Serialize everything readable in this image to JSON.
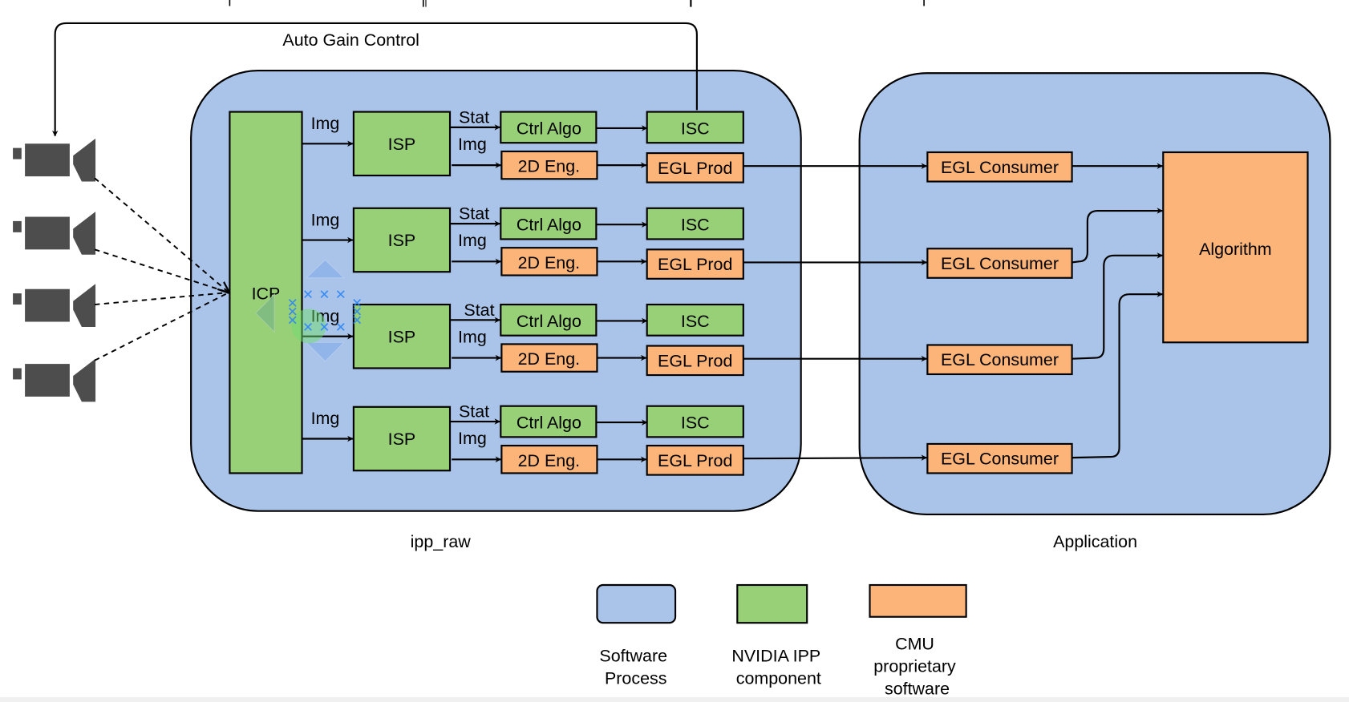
{
  "colors": {
    "software_process": "#a9c4e8",
    "nvidia_component": "#97d077",
    "cmu_software": "#fdb478",
    "stroke": "#000000",
    "camera": "#4d4d4d",
    "selection_handle": "#3399ff"
  },
  "top_labels": {
    "agc": "Auto Gain Control"
  },
  "containers": {
    "ipp_raw": "ipp_raw",
    "application": "Application"
  },
  "icp": {
    "label": "ICP"
  },
  "pipelines": [
    {
      "img_in": "Img",
      "isp": "ISP",
      "stat": "Stat",
      "img_out": "Img",
      "ctrl": "Ctrl Algo",
      "eng": "2D Eng.",
      "isc": "ISC",
      "prod": "EGL Prod",
      "consumer": "EGL Consumer"
    },
    {
      "img_in": "Img",
      "isp": "ISP",
      "stat": "Stat",
      "img_out": "Img",
      "ctrl": "Ctrl Algo",
      "eng": "2D Eng.",
      "isc": "ISC",
      "prod": "EGL Prod",
      "consumer": "EGL Consumer"
    },
    {
      "img_in": "Img",
      "isp": "ISP",
      "stat": "Stat",
      "img_out": "Img",
      "ctrl": "Ctrl Algo",
      "eng": "2D Eng.",
      "isc": "ISC",
      "prod": "EGL Prod",
      "consumer": "EGL Consumer"
    },
    {
      "img_in": "Img",
      "isp": "ISP",
      "stat": "Stat",
      "img_out": "Img",
      "ctrl": "Ctrl Algo",
      "eng": "2D Eng.",
      "isc": "ISC",
      "prod": "EGL Prod",
      "consumer": "EGL Consumer"
    }
  ],
  "algorithm": {
    "label": "Algorithm"
  },
  "cameras": [
    "camera-icon",
    "camera-icon",
    "camera-icon",
    "camera-icon"
  ],
  "legend": [
    {
      "lines": [
        "Software",
        "Process"
      ]
    },
    {
      "lines": [
        "NVIDIA IPP",
        "component"
      ]
    },
    {
      "lines": [
        "CMU",
        "proprietary",
        "software"
      ]
    }
  ]
}
